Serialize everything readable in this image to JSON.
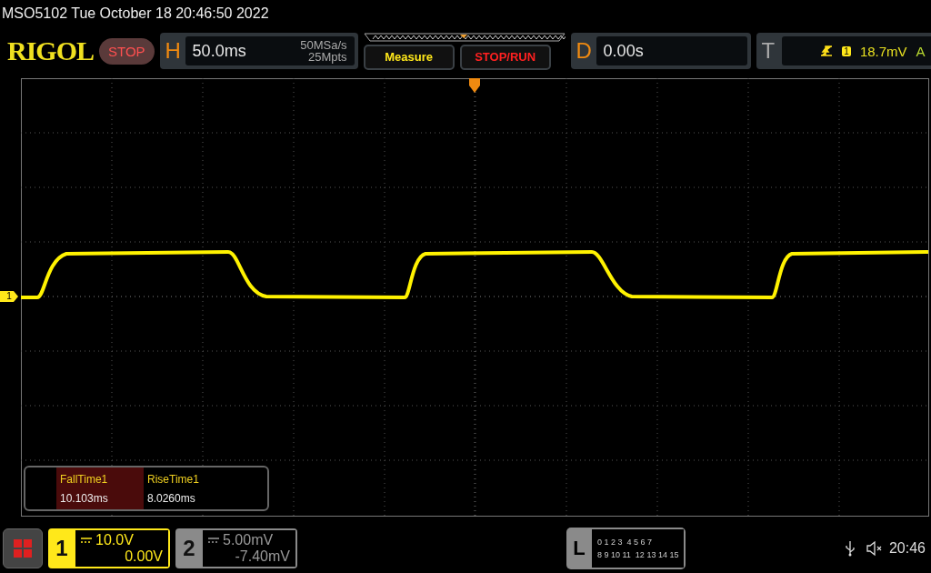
{
  "status_line": "MSO5102  Tue October 18 20:46:50 2022",
  "header": {
    "logo": "RIGOL",
    "run_state": "STOP",
    "horizontal": {
      "label": "H",
      "timebase": "50.0ms",
      "sample_rate": "50MSa/s",
      "memory_depth": "25Mpts"
    },
    "measure_button": "Measure",
    "stop_run_button": "STOP/RUN",
    "delay": {
      "label": "D",
      "value": "0.00s"
    },
    "trigger": {
      "label": "T",
      "source": "1",
      "level": "18.7mV",
      "mode": "A"
    }
  },
  "grid": {
    "channel_marker": "1"
  },
  "measurements": [
    {
      "name": "FallTime1",
      "value": "10.103ms",
      "selected": true
    },
    {
      "name": "RiseTime1",
      "value": "8.0260ms",
      "selected": false
    }
  ],
  "channels": [
    {
      "number": "1",
      "scale": "10.0V",
      "offset": "0.00V",
      "selected": true
    },
    {
      "number": "2",
      "scale": "5.00mV",
      "offset": "-7.40mV",
      "selected": false
    }
  ],
  "logic": {
    "label": "L",
    "rows": [
      "0 1 2 3  4 5 6 7",
      "8 9 10 11  12 13 14 15"
    ]
  },
  "clock": "20:46"
}
